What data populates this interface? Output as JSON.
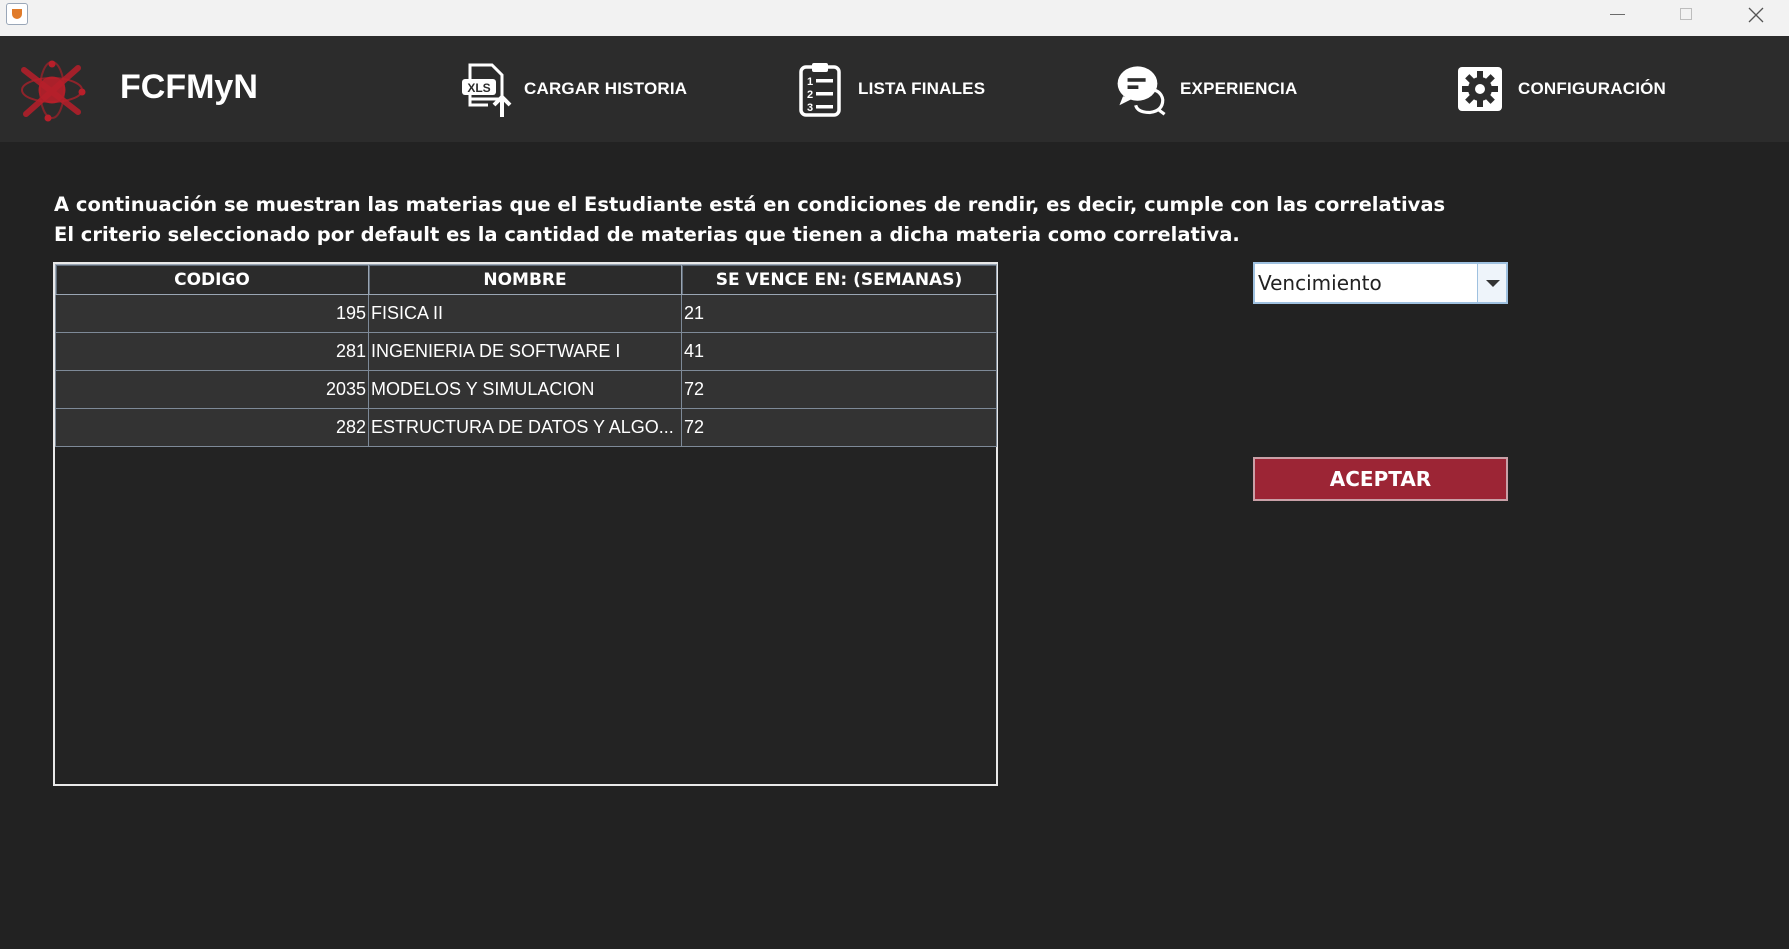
{
  "window": {
    "minimize_icon": "minimize-icon",
    "maximize_icon": "maximize-icon",
    "close_icon": "close-icon"
  },
  "header": {
    "brand": "FCFMyN",
    "nav": [
      {
        "label": "CARGAR HISTORIA",
        "icon": "xls-upload-icon"
      },
      {
        "label": "LISTA FINALES",
        "icon": "clipboard-list-icon"
      },
      {
        "label": "EXPERIENCIA",
        "icon": "chat-bubble-icon"
      },
      {
        "label": "CONFIGURACIÓN",
        "icon": "gear-icon"
      }
    ]
  },
  "description": {
    "line1": "A continuación se muestran las materias que el Estudiante está en condiciones de rendir, es decir, cumple con las correlativas",
    "line2": "El criterio seleccionado por default es la cantidad de materias que tienen a dicha materia como correlativa."
  },
  "table": {
    "headers": [
      "CODIGO",
      "NOMBRE",
      "SE VENCE EN: (SEMANAS)"
    ],
    "rows": [
      {
        "codigo": "195",
        "nombre": "FISICA II",
        "vence": "21"
      },
      {
        "codigo": "281",
        "nombre": "INGENIERIA DE SOFTWARE I",
        "vence": "41"
      },
      {
        "codigo": "2035",
        "nombre": "MODELOS Y SIMULACION",
        "vence": "72"
      },
      {
        "codigo": "282",
        "nombre": "ESTRUCTURA DE DATOS Y ALGO...",
        "vence": "72"
      }
    ]
  },
  "criteria": {
    "selected": "Vencimiento"
  },
  "actions": {
    "accept_label": "ACEPTAR"
  },
  "colors": {
    "background": "#222222",
    "header_bg": "#2c2c2c",
    "accent": "#9c2535",
    "logo_red": "#c0202a"
  }
}
